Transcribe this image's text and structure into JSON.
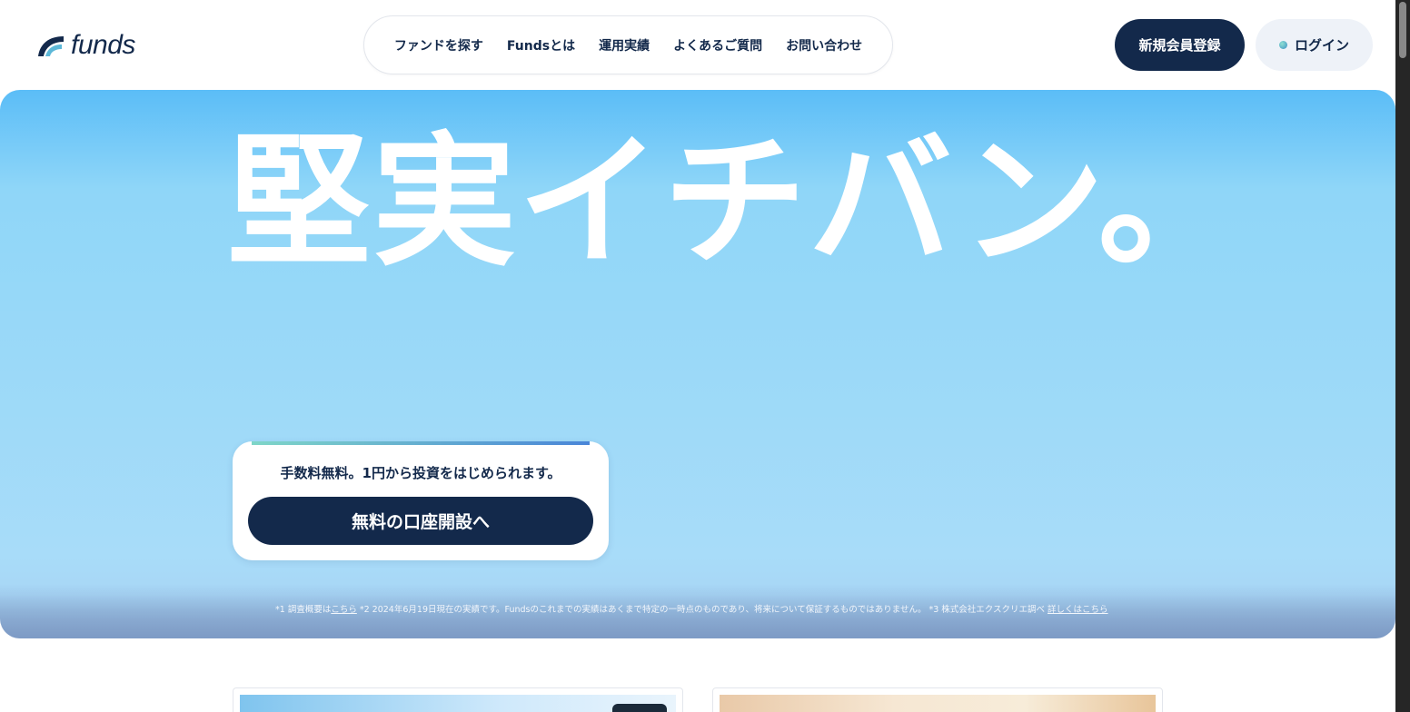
{
  "header": {
    "logo_text": "funds",
    "nav": [
      {
        "label": "ファンドを探す"
      },
      {
        "label": "Fundsとは"
      },
      {
        "label": "運用実績"
      },
      {
        "label": "よくあるご質問"
      },
      {
        "label": "お問い合わせ"
      }
    ],
    "register_label": "新規会員登録",
    "login_label": "ログイン"
  },
  "hero": {
    "title": "堅実イチバン。",
    "cta_text": "手数料無料。1円から投資をはじめられます。",
    "cta_button": "無料の口座開設へ",
    "footnote": {
      "part1": "*1 調査概要は",
      "link1": "こちら",
      "part2": " *2 2024年6月19日現在の実績です。Fundsのこれまでの実績はあくまで特定の一時点のものであり、将来について保証するものではありません。 *3 株式会社エクスクリエ調べ ",
      "link2": "詳しくはこちら"
    }
  },
  "colors": {
    "navy": "#13294b",
    "hero_top": "#5bbdf7",
    "hero_mid": "#9bd9f8",
    "login_bg": "#eef2f8"
  }
}
